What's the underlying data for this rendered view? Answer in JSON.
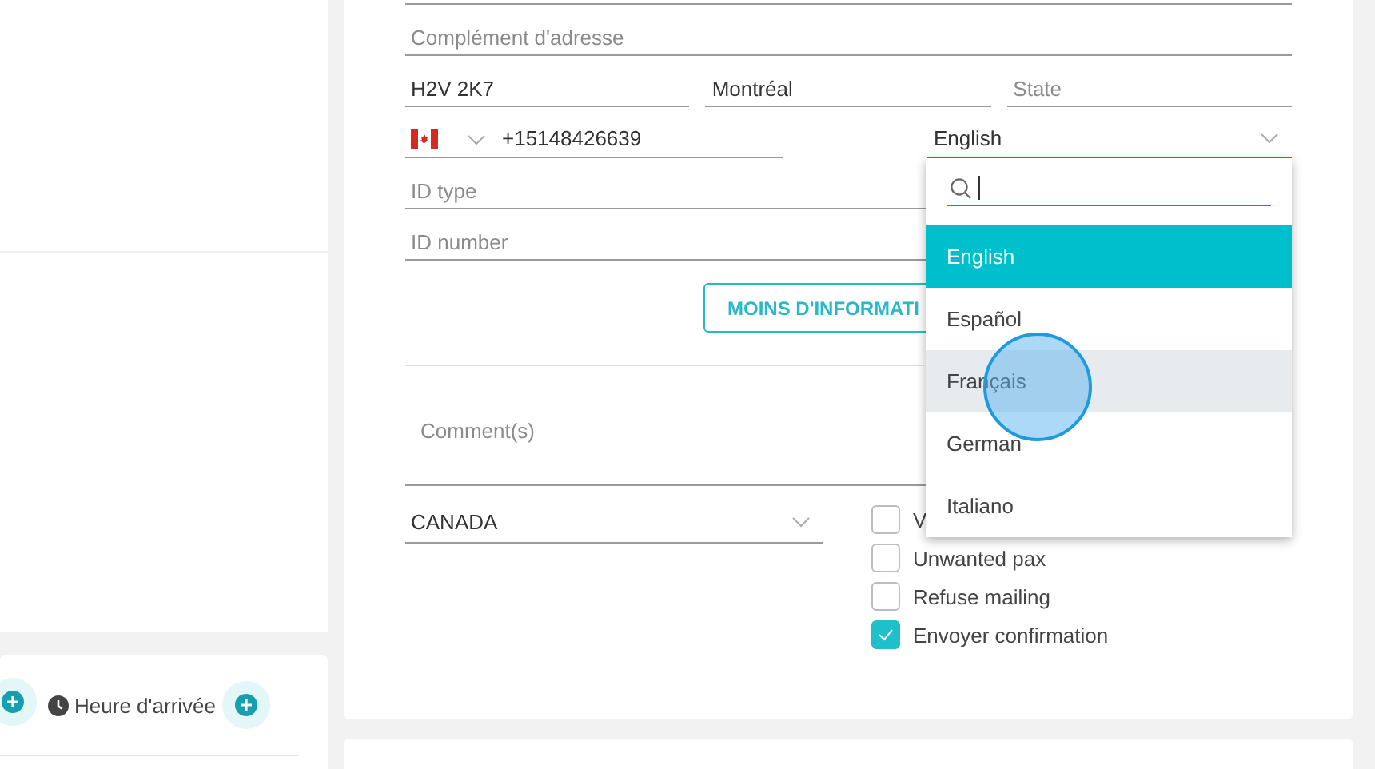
{
  "arrival_card": {
    "label": "Heure d'arrivée"
  },
  "form": {
    "address_complement": {
      "placeholder": "Complément d'adresse"
    },
    "postal_code": {
      "value": "H2V 2K7"
    },
    "city": {
      "value": "Montréal"
    },
    "state": {
      "placeholder": "State"
    },
    "phone": {
      "value": "+15148426639"
    },
    "language": {
      "value": "English",
      "open": true
    },
    "id_type": {
      "placeholder": "ID type"
    },
    "id_number": {
      "placeholder": "ID number"
    },
    "less_info_button": "MOINS D'INFORMATI",
    "comments": {
      "placeholder": "Comment(s)"
    },
    "country": {
      "value": "CANADA"
    },
    "checkboxes": [
      {
        "label": "V",
        "checked": false
      },
      {
        "label": "Unwanted pax",
        "checked": false
      },
      {
        "label": "Refuse mailing",
        "checked": false
      },
      {
        "label": "Envoyer confirmation",
        "checked": true
      }
    ]
  },
  "language_dropdown": {
    "options": [
      {
        "label": "English",
        "selected": true,
        "hovered": false
      },
      {
        "label": "Español",
        "selected": false,
        "hovered": false
      },
      {
        "label": "Français",
        "selected": false,
        "hovered": true
      },
      {
        "label": "German",
        "selected": false,
        "hovered": false
      },
      {
        "label": "Italiano",
        "selected": false,
        "hovered": false
      }
    ]
  }
}
